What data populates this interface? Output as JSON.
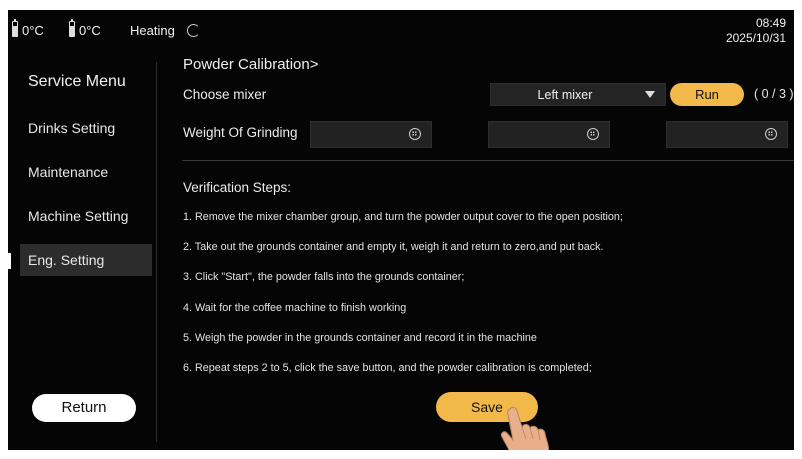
{
  "status": {
    "temp1": "0°C",
    "temp2": "0°C",
    "mode": "Heating",
    "time": "08:49",
    "date": "2025/10/31"
  },
  "sidebar": {
    "title": "Service Menu",
    "items": [
      {
        "label": "Drinks Setting"
      },
      {
        "label": "Maintenance"
      },
      {
        "label": "Machine Setting"
      },
      {
        "label": "Eng. Setting"
      }
    ],
    "active_index": 3,
    "return_label": "Return"
  },
  "panel": {
    "title": "Powder Calibration>",
    "mixer_label": "Choose mixer",
    "mixer_value": "Left mixer",
    "run_label": "Run",
    "counter": "( 0 / 3 )",
    "weight_label": "Weight Of Grinding",
    "weight_values": [
      "",
      "",
      ""
    ],
    "steps_title": "Verification Steps:",
    "steps": [
      "1. Remove the mixer chamber group, and turn the powder output cover to the open position;",
      "2. Take out the grounds container and empty it, weigh it and return to zero,and put back.",
      "3. Click \"Start\", the powder falls into the grounds container;",
      "4. Wait for the coffee machine to finish working",
      "5. Weigh the powder in the grounds container and record it in the machine",
      "6. Repeat steps 2 to 5, click the save button, and the powder calibration is completed;"
    ],
    "save_label": "Save"
  },
  "colors": {
    "accent": "#f2b84a",
    "background": "#050505",
    "active_item": "#2c2c2c"
  },
  "icons": [
    "battery-icon",
    "loading-spinner-icon",
    "keyboard-icon",
    "dropdown-caret-icon",
    "hand-pointer-icon"
  ]
}
